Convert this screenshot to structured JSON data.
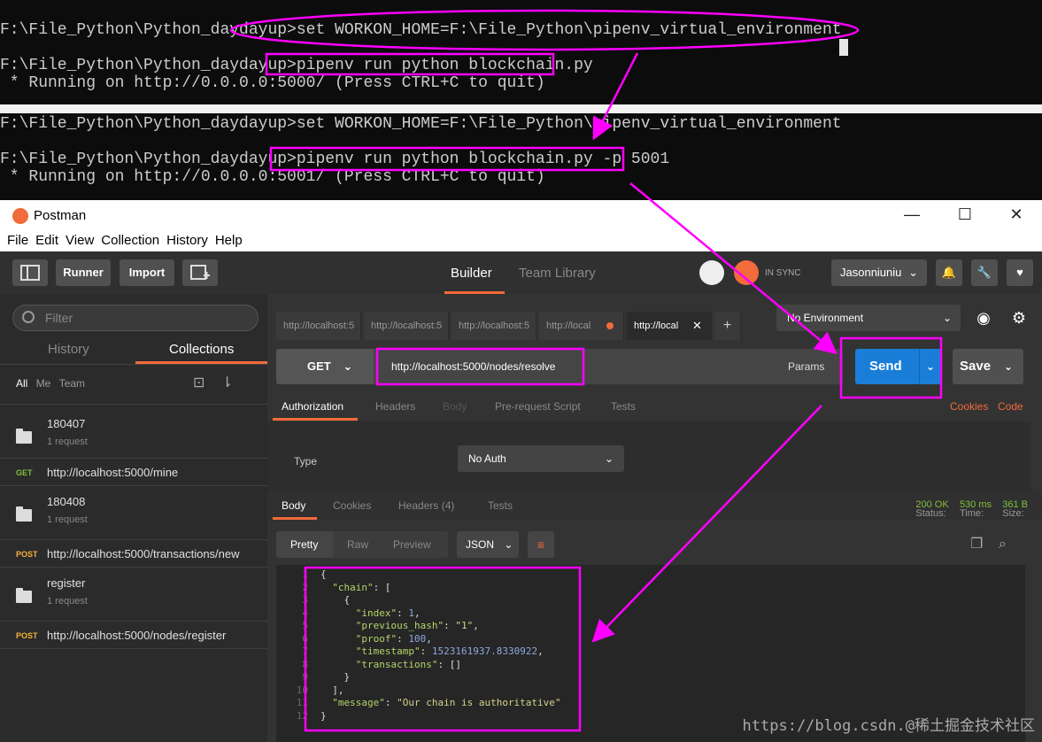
{
  "terminal1": {
    "line1": "F:\\File_Python\\Python_daydayup>set WORKON_HOME=F:\\File_Python\\pipenv_virtual_environment",
    "line2": "F:\\File_Python\\Python_daydayup>pipenv run python blockchain.py",
    "line3": " * Running on http://0.0.0.0:5000/ (Press CTRL+C to quit)"
  },
  "terminal2": {
    "line1": "F:\\File_Python\\Python_daydayup>set WORKON_HOME=F:\\File_Python\\pipenv_virtual_environment",
    "line2": "F:\\File_Python\\Python_daydayup>pipenv run python blockchain.py -p 5001",
    "line3": " * Running on http://0.0.0.0:5001/ (Press CTRL+C to quit)"
  },
  "window": {
    "title": "Postman",
    "minimize": "—",
    "maximize": "☐",
    "close": "✕"
  },
  "menu": [
    "File",
    "Edit",
    "View",
    "Collection",
    "History",
    "Help"
  ],
  "topbar": {
    "runner": "Runner",
    "import": "Import",
    "builder": "Builder",
    "team_library": "Team Library",
    "sync": "IN SYNC",
    "user": "Jasonniuniu"
  },
  "sidebar": {
    "filter_placeholder": "Filter",
    "tab_history": "History",
    "tab_collections": "Collections",
    "filter_all": "All",
    "filter_me": "Me",
    "filter_team": "Team",
    "items": [
      {
        "type": "folder",
        "name": "180407",
        "sub": "1 request"
      },
      {
        "type": "request",
        "method": "GET",
        "name": "http://localhost:5000/mine"
      },
      {
        "type": "folder",
        "name": "180408",
        "sub": "1 request"
      },
      {
        "type": "request",
        "method": "POST",
        "name": "http://localhost:5000/transactions/new"
      },
      {
        "type": "folder",
        "name": "register",
        "sub": "1 request"
      },
      {
        "type": "request",
        "method": "POST",
        "name": "http://localhost:5000/nodes/register"
      }
    ]
  },
  "tabs": [
    "http://localhost:5",
    "http://localhost:5",
    "http://localhost:5",
    "http://local",
    "http://local"
  ],
  "environment": "No Environment",
  "request": {
    "method": "GET",
    "url": "http://localhost:5000/nodes/resolve",
    "params": "Params",
    "send": "Send",
    "save": "Save"
  },
  "req_tabs": {
    "authorization": "Authorization",
    "headers": "Headers",
    "body": "Body",
    "prerequest": "Pre-request Script",
    "tests": "Tests",
    "cookies": "Cookies",
    "code": "Code"
  },
  "auth": {
    "type_label": "Type",
    "type_value": "No Auth"
  },
  "resp_tabs": {
    "body": "Body",
    "cookies": "Cookies",
    "headers": "Headers (4)",
    "tests": "Tests"
  },
  "status": {
    "status_label": "Status:",
    "status_value": "200 OK",
    "time_label": "Time:",
    "time_value": "530 ms",
    "size_label": "Size:",
    "size_value": "361 B"
  },
  "format": {
    "pretty": "Pretty",
    "raw": "Raw",
    "preview": "Preview",
    "json": "JSON"
  },
  "response": {
    "index_key": "\"index\"",
    "index_val": "1",
    "prev_key": "\"previous_hash\"",
    "prev_val": "\"1\"",
    "proof_key": "\"proof\"",
    "proof_val": "100",
    "ts_key": "\"timestamp\"",
    "ts_val": "1523161937.8330922",
    "tx_key": "\"transactions\"",
    "tx_val": "[]",
    "chain_key": "\"chain\"",
    "msg_key": "\"message\"",
    "msg_val": "\"Our chain is authoritative\""
  },
  "watermark": "https://blog.csdn.@稀土掘金技术社区",
  "colors": {
    "highlight": "#ff00ff",
    "accent": "#f26b3a",
    "send": "#1a7ed8"
  }
}
